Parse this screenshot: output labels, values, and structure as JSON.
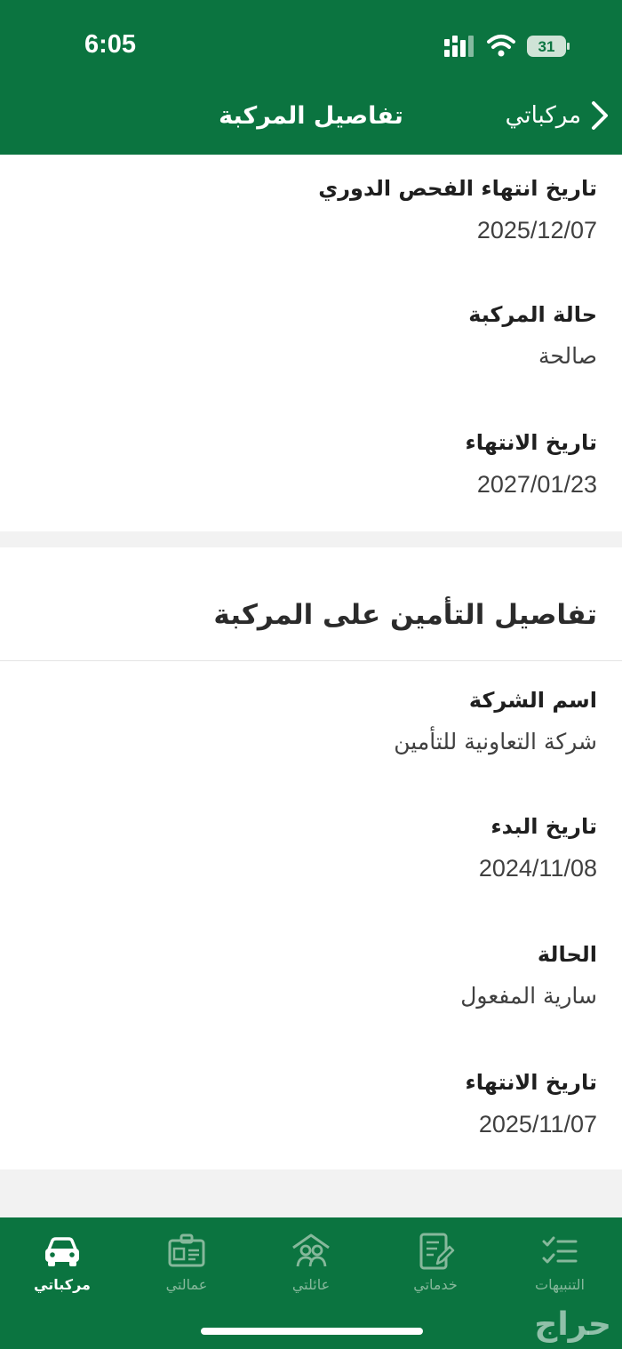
{
  "status_bar": {
    "time": "6:05",
    "battery_level": "31"
  },
  "nav": {
    "title": "تفاصيل المركبة",
    "back_label": "مركباتي"
  },
  "vehicle_fields": [
    {
      "label": "تاريخ انتهاء الفحص الدوري",
      "value": "2025/12/07"
    },
    {
      "label": "حالة المركبة",
      "value": "صالحة"
    },
    {
      "label": "تاريخ الانتهاء",
      "value": "2027/01/23"
    }
  ],
  "insurance": {
    "title": "تفاصيل التأمين على المركبة",
    "fields": [
      {
        "label": "اسم الشركة",
        "value": "شركة التعاونية للتأمين"
      },
      {
        "label": "تاريخ البدء",
        "value": "2024/11/08"
      },
      {
        "label": "الحالة",
        "value": "سارية المفعول"
      },
      {
        "label": "تاريخ الانتهاء",
        "value": "2025/11/07"
      }
    ]
  },
  "tabs": [
    {
      "label": "مركباتي",
      "icon": "car-icon",
      "active": true
    },
    {
      "label": "عمالتي",
      "icon": "id-badge-icon",
      "active": false
    },
    {
      "label": "عائلتي",
      "icon": "family-icon",
      "active": false
    },
    {
      "label": "خدماتي",
      "icon": "services-icon",
      "active": false
    },
    {
      "label": "التنبيهات",
      "icon": "checklist-icon",
      "active": false
    }
  ],
  "watermark": "حراج",
  "colors": {
    "brand_green": "#0b7440",
    "inactive_tab": "#86b89b"
  }
}
